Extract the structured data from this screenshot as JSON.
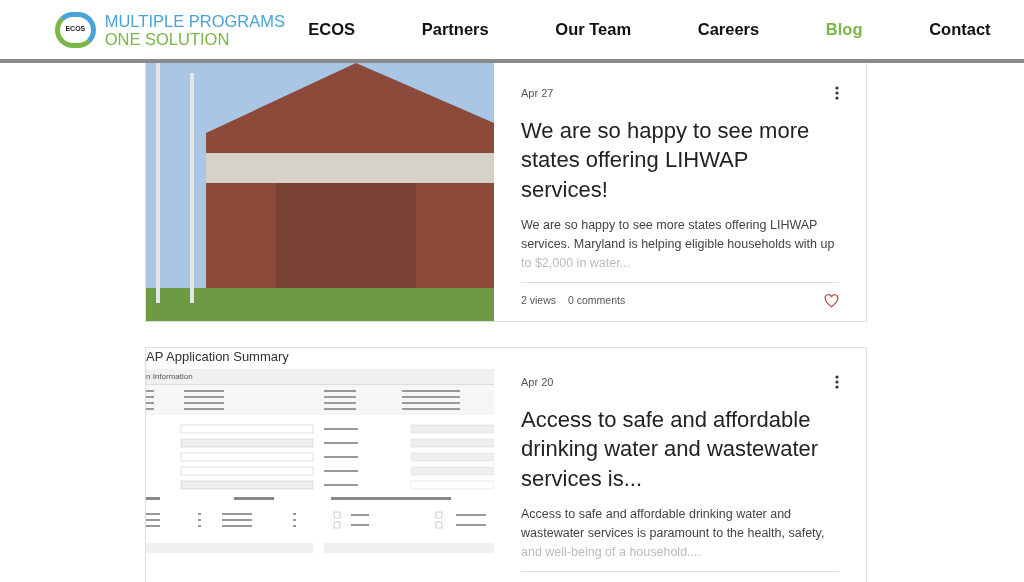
{
  "header": {
    "logo": {
      "badge": "ECOS",
      "line1": "MULTIPLE PROGRAMS",
      "line2": "ONE SOLUTION"
    },
    "nav": [
      {
        "label": "ECOS",
        "selected": false
      },
      {
        "label": "Partners",
        "selected": false
      },
      {
        "label": "Our Team",
        "selected": false
      },
      {
        "label": "Careers",
        "selected": false
      },
      {
        "label": "Blog",
        "selected": true
      },
      {
        "label": "Contact",
        "selected": false
      }
    ]
  },
  "posts": [
    {
      "kind": "photo",
      "date": "Apr 27",
      "title": "We are so happy to see more states offering LIHWAP services!",
      "excerpt": [
        "We are so happy to see more states offering LIHWAP",
        "services. Maryland is helping eligible households with up",
        "to $2,000 in water..."
      ],
      "views": "2 views",
      "comments": "0 comments",
      "liked": false
    },
    {
      "kind": "screenshot",
      "date": "Apr 20",
      "title": "Access to safe and affordable drinking water and wastewater services is...",
      "excerpt": [
        "Access to safe and affordable drinking water and",
        "wastewater services is paramount to the health, safety,",
        "and well-being of a household...."
      ],
      "app_screenshot": {
        "title": "AP Application Summary",
        "section": "n Information"
      }
    }
  ]
}
